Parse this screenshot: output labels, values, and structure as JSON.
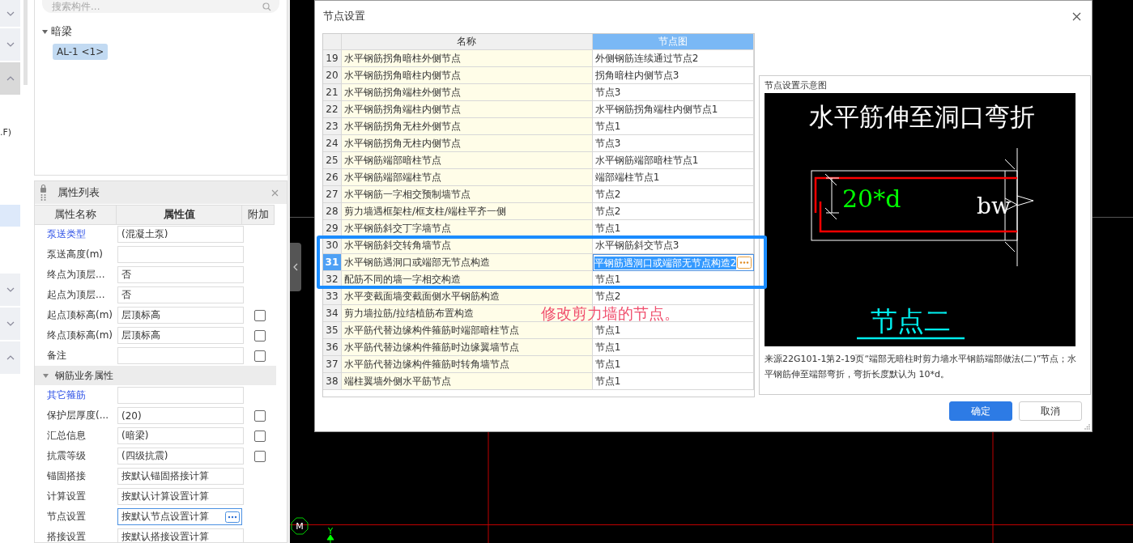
{
  "left_strip": {
    "fragment": ".F)"
  },
  "component_panel": {
    "search": {
      "placeholder": "搜索构件..."
    },
    "tree": [
      {
        "label": "暗梁",
        "expanded": true,
        "children": [
          {
            "label": "AL-1 <1>",
            "selected": true
          }
        ]
      }
    ]
  },
  "properties": {
    "title": "属性列表",
    "columns": [
      "属性名称",
      "属性值",
      "附加"
    ],
    "rows": [
      {
        "kind": "field",
        "name": "泵送类型",
        "link": true,
        "value": "(混凝土泵)"
      },
      {
        "kind": "field",
        "name": "泵送高度(m)",
        "link": false
      },
      {
        "kind": "field",
        "name": "终点为顶层...",
        "link": false,
        "value": "否"
      },
      {
        "kind": "field",
        "name": "起点为顶层...",
        "link": false,
        "value": "否"
      },
      {
        "kind": "field",
        "name": "起点顶标高(m)",
        "link": false,
        "value": "层顶标高",
        "checked": false
      },
      {
        "kind": "field",
        "name": "终点顶标高(m)",
        "link": false,
        "value": "层顶标高",
        "checked": false
      },
      {
        "kind": "field",
        "name": "备注",
        "link": false,
        "checked": false
      },
      {
        "kind": "group",
        "name": "钢筋业务属性",
        "expanded": true
      },
      {
        "kind": "field",
        "name": "其它箍筋",
        "link": true
      },
      {
        "kind": "field",
        "name": "保护层厚度(...",
        "link": false,
        "value": "(20)",
        "checked": false
      },
      {
        "kind": "field",
        "name": "汇总信息",
        "link": false,
        "value": "(暗梁)",
        "checked": false
      },
      {
        "kind": "field",
        "name": "抗震等级",
        "link": false,
        "value": "(四级抗震)",
        "checked": false
      },
      {
        "kind": "field",
        "name": "锚固搭接",
        "link": false,
        "value": "按默认锚固搭接计算"
      },
      {
        "kind": "field",
        "name": "计算设置",
        "link": false,
        "value": "按默认计算设置计算"
      },
      {
        "kind": "picker",
        "name": "节点设置",
        "link": false,
        "value": "按默认节点设置计算",
        "focused": true
      },
      {
        "kind": "field",
        "name": "搭接设置",
        "link": false,
        "value": "按默认搭接设置计算"
      }
    ]
  },
  "canvas": {
    "marker": "M",
    "axis": "Y"
  },
  "dialog": {
    "title": "节点设置",
    "table": {
      "columns": [
        {
          "label": "名称",
          "selected": false
        },
        {
          "label": "节点图",
          "selected": true
        }
      ],
      "rows": [
        {
          "number": "19",
          "name": "水平钢筋拐角暗柱外侧节点",
          "value": "外侧钢筋连续通过节点2",
          "selected": false
        },
        {
          "number": "20",
          "name": "水平钢筋拐角暗柱内侧节点",
          "value": "拐角暗柱内侧节点3",
          "selected": false
        },
        {
          "number": "21",
          "name": "水平钢筋拐角端柱外侧节点",
          "value": "节点3",
          "selected": false
        },
        {
          "number": "22",
          "name": "水平钢筋拐角端柱内侧节点",
          "value": "水平钢筋拐角端柱内侧节点1",
          "selected": false
        },
        {
          "number": "23",
          "name": "水平钢筋拐角无柱外侧节点",
          "value": "节点1",
          "selected": false
        },
        {
          "number": "24",
          "name": "水平钢筋拐角无柱内侧节点",
          "value": "节点3",
          "selected": false
        },
        {
          "number": "25",
          "name": "水平钢筋端部暗柱节点",
          "value": "水平钢筋端部暗柱节点1",
          "selected": false
        },
        {
          "number": "26",
          "name": "水平钢筋端部端柱节点",
          "value": "端部端柱节点1",
          "selected": false
        },
        {
          "number": "27",
          "name": "水平钢筋一字相交预制墙节点",
          "value": "节点2",
          "selected": false
        },
        {
          "number": "28",
          "name": "剪力墙遇框架柱/框支柱/端柱平齐一侧",
          "value": "节点2",
          "selected": false
        },
        {
          "number": "29",
          "name": "水平钢筋斜交丁字墙节点",
          "value": "节点1",
          "selected": false
        },
        {
          "number": "30",
          "name": "水平钢筋斜交转角墙节点",
          "value": "水平钢筋斜交节点3",
          "selected": false
        },
        {
          "number": "31",
          "name": "水平钢筋遇洞口或端部无节点构造",
          "value": "平钢筋遇洞口或端部无节点构造2",
          "selected": true
        },
        {
          "number": "32",
          "name": "配筋不同的墙一字相交构造",
          "value": "节点1",
          "selected": false
        },
        {
          "number": "33",
          "name": "水平变截面墙变截面侧水平钢筋构造",
          "value": "节点2",
          "selected": false
        },
        {
          "number": "34",
          "name": "剪力墙拉筋/拉结植筋布置构造",
          "selected": false
        },
        {
          "number": "35",
          "name": "水平筋代替边缘构件箍筋时端部暗柱节点",
          "value": "节点1",
          "selected": false
        },
        {
          "number": "36",
          "name": "水平筋代替边缘构件箍筋时边缘翼墙节点",
          "value": "节点1",
          "selected": false
        },
        {
          "number": "37",
          "name": "水平筋代替边缘构件箍筋时转角墙节点",
          "value": "节点1",
          "selected": false
        },
        {
          "number": "38",
          "name": "端柱翼墙外侧水平筋节点",
          "value": "节点1",
          "selected": false
        }
      ]
    },
    "annotation": {
      "text": "修改剪力墙的节点。"
    },
    "preview": {
      "label": "节点设置示意图",
      "diagram": {
        "title": "水平筋伸至洞口弯折",
        "dimension": "20*d",
        "width_label": "bw",
        "node_label": "节点二"
      },
      "description": "来源22G101-1第2-19页“端部无暗柱时剪力墙水平钢筋端部做法(二)”节点；水平钢筋伸至端部弯折，弯折长度默认为 10*d。"
    },
    "buttons": [
      {
        "label": "确定",
        "kind": "primary"
      },
      {
        "label": "取消",
        "kind": "secondary"
      }
    ]
  }
}
